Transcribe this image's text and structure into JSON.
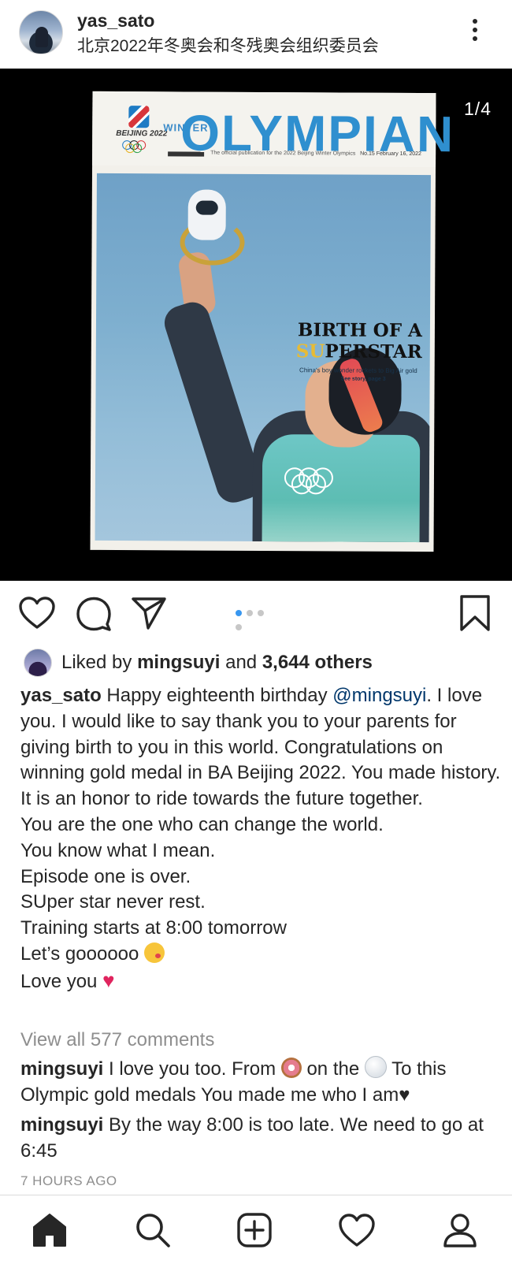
{
  "header": {
    "username": "yas_sato",
    "location": "北京2022年冬奥会和冬残奥会组织委员会"
  },
  "media": {
    "counter": "1/4",
    "magazine": {
      "logo_text": "BEIJING 2022",
      "winter_label": "WINTER",
      "title": "OLYMPIAN",
      "publisher": "CHINA DAILY",
      "tagline": "The official publication for the 2022 Beijing Winter Olympics",
      "issue": "No.15 February 16, 2022",
      "headline_1": "BIRTH OF A",
      "headline_2_accent": "SU",
      "headline_2_rest": "PERSTAR",
      "subhead": "China's boy wonder rockets to Big Air gold",
      "see_story": "See story, page 3"
    },
    "carousel": {
      "total": 4,
      "active_index": 0
    }
  },
  "likes": {
    "prefix": "Liked by ",
    "liker": "mingsuyi",
    "middle": " and ",
    "others": "3,644 others"
  },
  "caption": {
    "username": "yas_sato",
    "line1_text": " Happy eighteenth birthday ",
    "mention": "@mingsuyi",
    "line1_end": ". I love you. I would like to say thank you to your parents for giving birth to you in this world. Congratulations on winning gold medal in BA Beijing 2022. You made history.",
    "lines": [
      "It is an honor to ride towards the future together.",
      "You are the one who can change the world.",
      "You know what I mean.",
      "Episode one is over.",
      "SUper star never rest.",
      "Training starts at 8:00 tomorrow"
    ],
    "line_gooo": "Let’s goooooo ",
    "line_love": "Love you "
  },
  "view_comments": "View all 577 comments",
  "comments": [
    {
      "username": "mingsuyi",
      "text_a": " I love you too. From ",
      "text_b": " on the ",
      "text_c": " To this Olympic gold medals You made me who I am"
    },
    {
      "username": "mingsuyi",
      "text": " By the way 8:00 is too late. We need to go at 6:45"
    }
  ],
  "timestamp": "7 HOURS AGO",
  "nav": [
    "home-icon",
    "search-icon",
    "new-post-icon",
    "activity-heart-icon",
    "profile-icon"
  ]
}
